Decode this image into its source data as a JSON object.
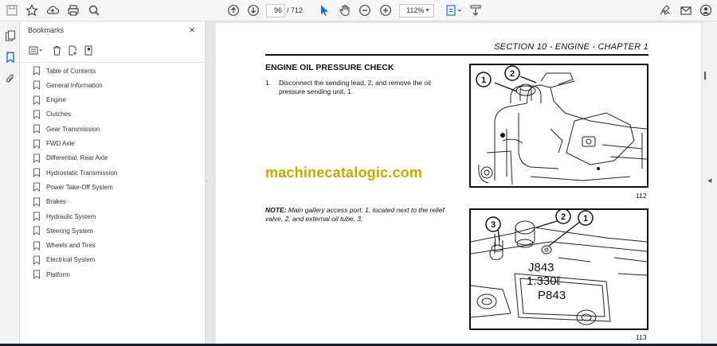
{
  "toolbar": {
    "page_current": "96",
    "page_total": "/ 712",
    "zoom": "112%"
  },
  "bookmarks": {
    "title": "Bookmarks",
    "close": "×",
    "items": [
      {
        "label": "Table of Contents"
      },
      {
        "label": "General Information"
      },
      {
        "label": "Engine"
      },
      {
        "label": "Clutches"
      },
      {
        "label": "Gear Transmission"
      },
      {
        "label": "FWD Axle"
      },
      {
        "label": "Differential, Rear Axle"
      },
      {
        "label": "Hydrostatic Transmission"
      },
      {
        "label": "Power Take-Off System"
      },
      {
        "label": "Brakes"
      },
      {
        "label": "Hydraulic System"
      },
      {
        "label": "Steering System"
      },
      {
        "label": "Wheels and Tires"
      },
      {
        "label": "Electrical System"
      },
      {
        "label": "Platform"
      }
    ]
  },
  "document": {
    "section_header": "SECTION 10 - ENGINE - CHAPTER 1",
    "heading": "ENGINE OIL PRESSURE CHECK",
    "step_number": "1.",
    "step_text": "Disconnect the sending lead, 2, and remove the oil pressure sending unit, 1.",
    "note_label": "NOTE:",
    "note_text": " Main gallery access port, 1, located next to the relief valve, 2, and external oil tube, 3.",
    "watermark": "machinecatalogic.com",
    "figure1": {
      "number": "112",
      "callouts": [
        "1",
        "2"
      ]
    },
    "figure2": {
      "number": "113",
      "callouts": [
        "3",
        "2",
        "1"
      ],
      "stamp_lines": [
        "J843",
        "1.330ℓ",
        "P843"
      ]
    }
  },
  "colors": {
    "watermark": "#c9a800",
    "accent_blue": "#1a6fd6"
  }
}
